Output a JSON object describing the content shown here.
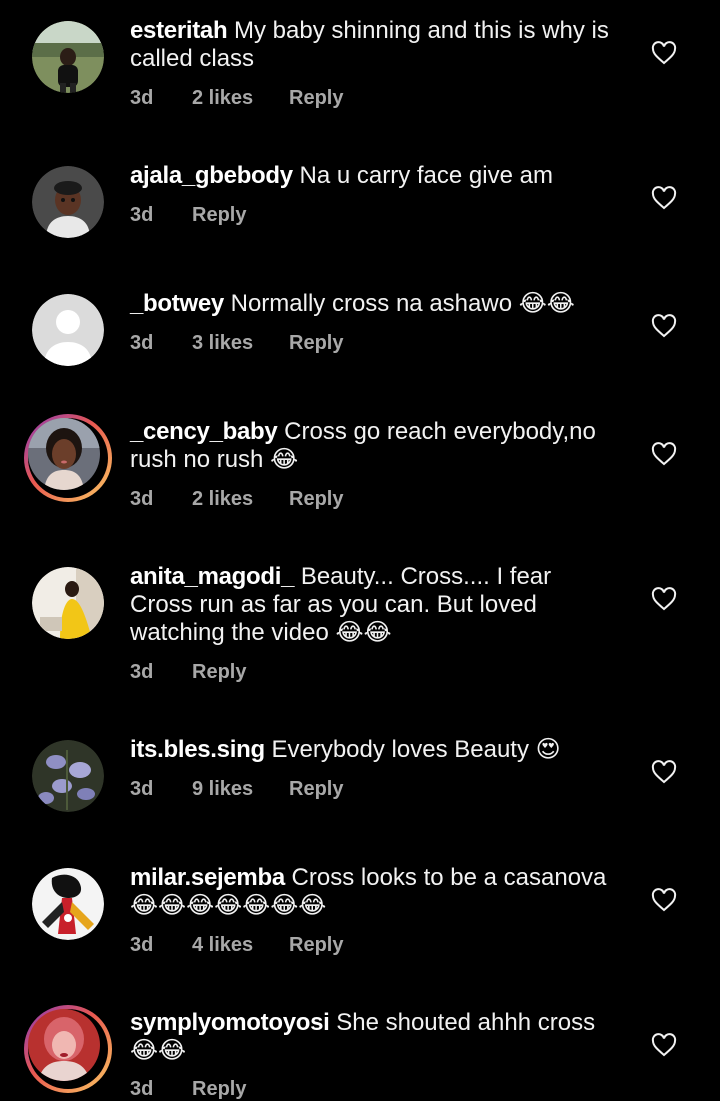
{
  "comments": [
    {
      "username": "esteritah",
      "text": "My baby shinning and this is why is called class",
      "time": "3d",
      "likes": "2 likes",
      "reply": "Reply",
      "avatar": "photo-person-outdoors"
    },
    {
      "username": "ajala_gbebody",
      "text": "Na u carry face give am",
      "time": "3d",
      "likes": "",
      "reply": "Reply",
      "avatar": "cartoon-avatar"
    },
    {
      "username": "_botwey",
      "text": "Normally cross na ashawo 😂😂",
      "time": "3d",
      "likes": "3 likes",
      "reply": "Reply",
      "avatar": "default-avatar"
    },
    {
      "username": "_cency_baby",
      "text": "Cross go reach everybody,no rush no rush 😂",
      "time": "3d",
      "likes": "2 likes",
      "reply": "Reply",
      "avatar": "photo-portrait-story"
    },
    {
      "username": "anita_magodi_",
      "text": "Beauty... Cross.... I fear Cross run as far as you can. But loved watching the video 😂😂",
      "time": "3d",
      "likes": "",
      "reply": "Reply",
      "avatar": "photo-person-yellow-dress"
    },
    {
      "username": "its.bles.sing",
      "text": "Everybody loves Beauty 😍",
      "time": "3d",
      "likes": "9 likes",
      "reply": "Reply",
      "avatar": "photo-flowers"
    },
    {
      "username": "milar.sejemba",
      "text": "Cross looks to be a casanova 😂😂😂😂😂😂😂",
      "time": "3d",
      "likes": "4 likes",
      "reply": "Reply",
      "avatar": "art-figure"
    },
    {
      "username": "symplyomotoyosi",
      "text": "She shouted ahhh cross 😂😂",
      "time": "3d",
      "likes": "",
      "reply": "Reply",
      "avatar": "photo-portrait-story-red"
    }
  ],
  "colors": {
    "background": "#000000",
    "text": "#f5f5f5",
    "meta": "#a8a8a8",
    "story_ring": [
      "#8a3ab9",
      "#e95950",
      "#fccc63"
    ]
  },
  "icons": {
    "like": "heart-outline-icon"
  }
}
